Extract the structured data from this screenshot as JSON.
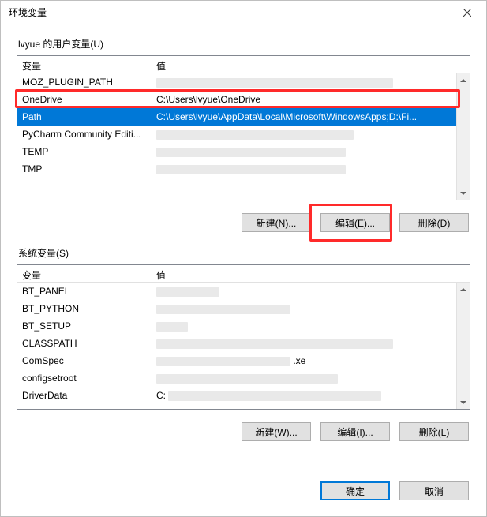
{
  "titlebar": {
    "title": "环境变量"
  },
  "user_section": {
    "label": "lvyue 的用户变量(U)",
    "header": {
      "name": "变量",
      "value": "值"
    },
    "rows": [
      {
        "name": "MOZ_PLUGIN_PATH",
        "value": "",
        "redacted": true,
        "rw": 300
      },
      {
        "name": "OneDrive",
        "value": "C:\\Users\\lvyue\\OneDrive",
        "redacted": false
      },
      {
        "name": "Path",
        "value": "C:\\Users\\lvyue\\AppData\\Local\\Microsoft\\WindowsApps;D:\\Fi...",
        "redacted": false,
        "selected": true
      },
      {
        "name": "PyCharm Community Editi...",
        "value": "",
        "redacted": true,
        "rw": 250
      },
      {
        "name": "TEMP",
        "value": "",
        "redacted": true,
        "rw": 240
      },
      {
        "name": "TMP",
        "value": "",
        "redacted": true,
        "rw": 240
      }
    ],
    "buttons": {
      "new": "新建(N)...",
      "edit": "编辑(E)...",
      "del": "删除(D)"
    }
  },
  "system_section": {
    "label": "系统变量(S)",
    "header": {
      "name": "变量",
      "value": "值"
    },
    "rows": [
      {
        "name": "BT_PANEL",
        "value": "",
        "redacted": true,
        "rw": 80
      },
      {
        "name": "BT_PYTHON",
        "value": "",
        "redacted": true,
        "rw": 170
      },
      {
        "name": "BT_SETUP",
        "value": "",
        "redacted": true,
        "rw": 40
      },
      {
        "name": "CLASSPATH",
        "value": "",
        "redacted": true,
        "rw": 300
      },
      {
        "name": "ComSpec",
        "value_prefix": "",
        "value_suffix": ".xe",
        "redacted": true,
        "rw": 170
      },
      {
        "name": "configsetroot",
        "value": "",
        "redacted": true,
        "rw": 230
      },
      {
        "name": "DriverData",
        "value_prefix": "C:",
        "value_suffix": "",
        "redacted": true,
        "rw": 270
      }
    ],
    "buttons": {
      "new": "新建(W)...",
      "edit": "编辑(I)...",
      "del": "删除(L)"
    }
  },
  "footer": {
    "ok": "确定",
    "cancel": "取消"
  }
}
